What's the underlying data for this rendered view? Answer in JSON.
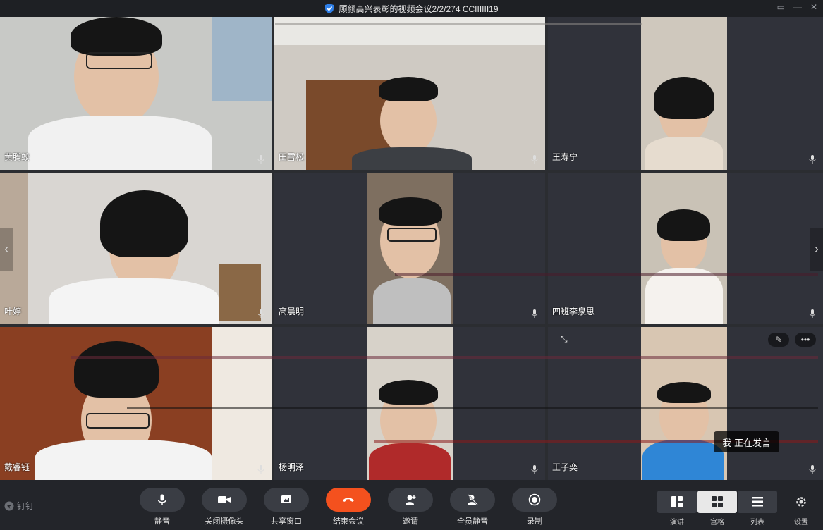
{
  "window": {
    "title": "顾颜高兴表彰的视频会议2/2/274 CCIIIIII19",
    "controls": [
      "▭",
      "—",
      "✕"
    ]
  },
  "participants": [
    {
      "name": "黄腾蛟",
      "shirt": "#f1f1f1",
      "bg": "#c8c9c6"
    },
    {
      "name": "田雪松",
      "shirt": "#3c3f44",
      "bg": "#6c5a48"
    },
    {
      "name": "王寿宁",
      "shirt": "#e6dccf",
      "bg": "#cfc8bd"
    },
    {
      "name": "叶婷",
      "shirt": "#f4f4f4",
      "bg": "#d9d6d2"
    },
    {
      "name": "高晨明",
      "shirt": "#bfbfbf",
      "bg": "#7e6f60"
    },
    {
      "name": "四班李泉思",
      "shirt": "#f5f2ee",
      "bg": "#c9c2b6"
    },
    {
      "name": "戴睿钰",
      "shirt": "#f3f3f3",
      "bg": "#8a3f22"
    },
    {
      "name": "杨明泽",
      "shirt": "#b02a2a",
      "bg": "#d7d2c9"
    },
    {
      "name": "王子奕",
      "shirt": "#2f86d6",
      "bg": "#d8c6b2"
    }
  ],
  "speaking_toast": "我 正在发言",
  "brand": "钉钉",
  "toolbar": {
    "buttons": [
      {
        "label": "静音",
        "icon": "microphone-icon"
      },
      {
        "label": "关闭摄像头",
        "icon": "camera-icon"
      },
      {
        "label": "共享窗口",
        "icon": "share-window-icon"
      },
      {
        "label": "结束会议",
        "icon": "hangup-icon"
      },
      {
        "label": "邀请",
        "icon": "invite-icon"
      },
      {
        "label": "全员静音",
        "icon": "mute-all-icon"
      },
      {
        "label": "录制",
        "icon": "record-icon"
      }
    ],
    "views": [
      {
        "label": "演讲",
        "active": false
      },
      {
        "label": "宫格",
        "active": true
      },
      {
        "label": "列表",
        "active": false
      }
    ],
    "settings_label": "设置"
  },
  "colors": {
    "end_call": "#f4511e",
    "toolbar_bg": "#23252a",
    "button_bg": "#3a3d44"
  }
}
